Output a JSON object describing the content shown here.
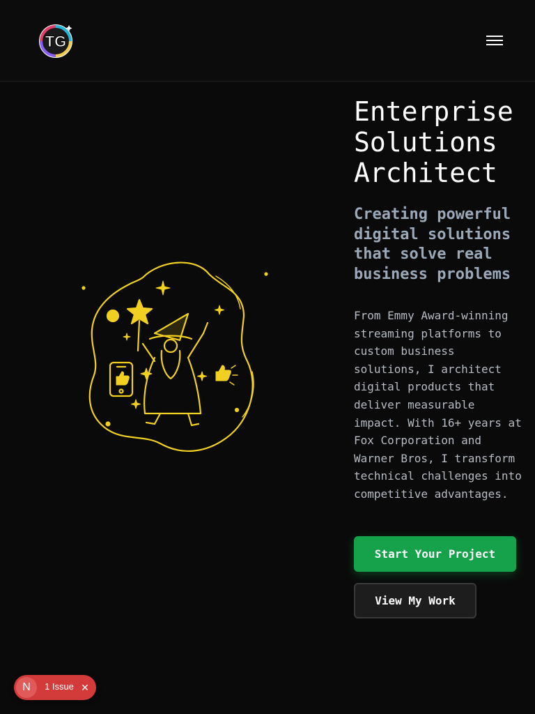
{
  "header": {
    "logo_text": "TG",
    "menu_icon": "hamburger-icon"
  },
  "hero": {
    "title": "Enterprise Solutions Architect",
    "subtitle": "Creating powerful digital solutions that solve real business problems",
    "description": "From Emmy Award-winning streaming platforms to custom business solutions, I architect digital products that deliver measurable impact. With 16+ years at Fox Corporation and Warner Bros, I transform technical challenges into competitive advantages.",
    "primary_cta": "Start Your Project",
    "secondary_cta": "View My Work",
    "illustration_icon": "wizard-illustration-icon"
  },
  "dev_overlay": {
    "badge_letter": "N",
    "issues_label": "1 Issue",
    "close_icon": "close-icon"
  },
  "colors": {
    "background": "#0a0a0a",
    "accent_green": "#16a24a",
    "illustration_yellow": "#f2d022",
    "issue_red": "#d33a3a"
  }
}
